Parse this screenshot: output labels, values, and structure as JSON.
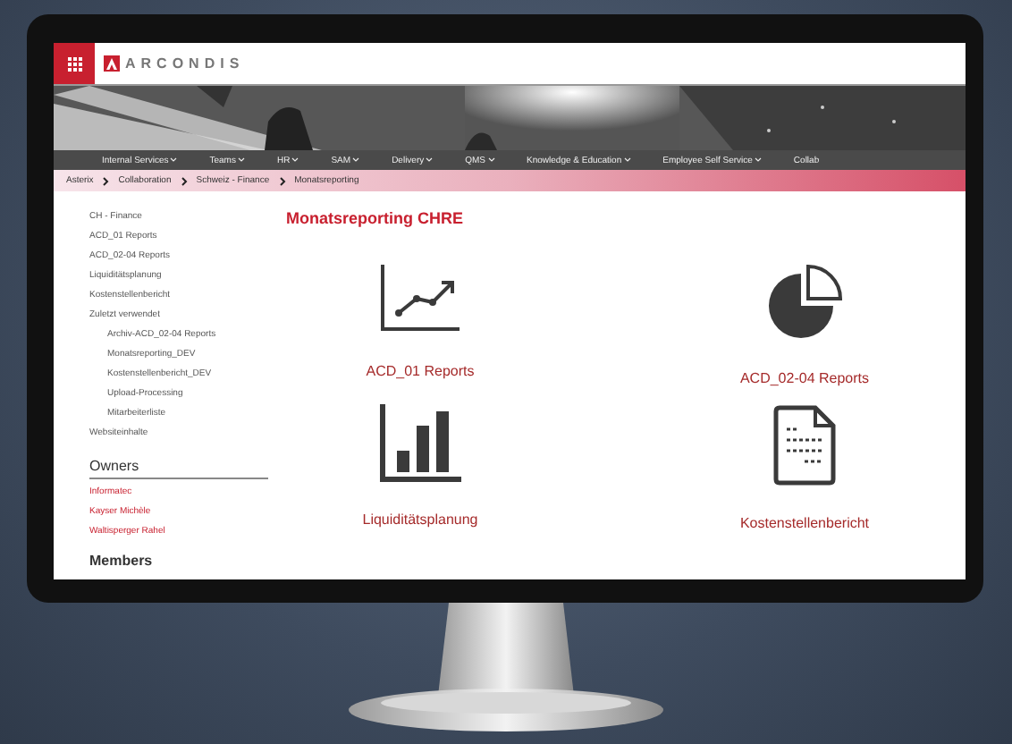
{
  "header": {
    "logo": "ARCONDIS"
  },
  "banner": {
    "kind": "picture"
  },
  "nav": [
    {
      "label": "Internal Services",
      "has_menu": true
    },
    {
      "label": "Teams",
      "has_menu": true
    },
    {
      "label": "HR",
      "has_menu": true
    },
    {
      "label": "SAM",
      "has_menu": true
    },
    {
      "label": "Delivery",
      "has_menu": true
    },
    {
      "label": "QMS",
      "has_menu": true
    },
    {
      "label": "Knowledge & Education",
      "has_menu": true
    },
    {
      "label": "Employee Self Service",
      "has_menu": true
    },
    {
      "label": "Collab",
      "has_menu": false
    }
  ],
  "breadcrumb": [
    "Asterix",
    "Collaboration",
    "Schweiz - Finance",
    "Monatsreporting"
  ],
  "sidebar": {
    "items": [
      {
        "label": "CH - Finance"
      },
      {
        "label": "ACD_01 Reports"
      },
      {
        "label": "ACD_02-04 Reports"
      },
      {
        "label": "Liquiditätsplanung"
      },
      {
        "label": "Kostenstellenbericht"
      },
      {
        "label": "Zuletzt verwendet",
        "children": [
          {
            "label": "Archiv-ACD_02-04 Reports"
          },
          {
            "label": "Monatsreporting_DEV"
          },
          {
            "label": "Kostenstellenbericht_DEV"
          },
          {
            "label": "Upload-Processing"
          },
          {
            "label": "Mitarbeiterliste"
          }
        ]
      },
      {
        "label": "Websiteinhalte"
      }
    ],
    "owners": {
      "title": "Owners",
      "people": [
        "Informatec",
        "Kayser Michèle",
        "Waltisperger Rahel"
      ]
    },
    "members": {
      "title": "Members"
    }
  },
  "page_title": "Monatsreporting CHRE",
  "tiles": [
    {
      "label": "ACD_01 Reports",
      "kind": "line_chart"
    },
    {
      "label": "ACD_02-04 Reports",
      "kind": "pie_chart"
    },
    {
      "label": "Liquiditätsplanung",
      "kind": "bar_chart"
    },
    {
      "label": "Kostenstellenbericht",
      "kind": "document"
    }
  ]
}
